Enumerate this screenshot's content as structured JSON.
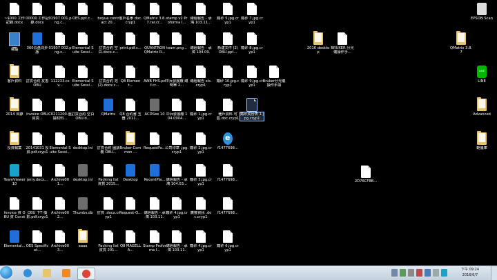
{
  "desktop": {
    "icons": [
      {
        "name": "file-icon",
        "kind": "file",
        "label": "~$000 工作記錄.docx"
      },
      {
        "name": "file-icon",
        "kind": "file",
        "label": "00000 工作記錄.docx"
      },
      {
        "name": "file-icon",
        "kind": "file",
        "label": "01907 001.png.c..."
      },
      {
        "name": "file-icon",
        "kind": "file",
        "label": "OES.ppt.c..."
      },
      {
        "name": "file-icon",
        "kind": "file",
        "label": "boyue contract 20..."
      },
      {
        "name": "file-icon",
        "kind": "file",
        "label": "客戶名單 doc.cryp1"
      },
      {
        "name": "file-icon",
        "kind": "file",
        "label": "QMatrix 3.8.7.rar.cr..."
      },
      {
        "name": "file-icon",
        "kind": "file",
        "label": "stamp v2 Proforma I..."
      },
      {
        "name": "file-icon",
        "kind": "file",
        "label": "總經報告 - 承鴻 103.11..."
      },
      {
        "name": "file-icon",
        "kind": "file",
        "label": "鐵砂 5.jpg.cryp1"
      },
      {
        "name": "file-icon",
        "kind": "file",
        "label": "鐵砂 7.jpg.cryp1"
      },
      {
        "name": "computer-icon",
        "kind": "pc",
        "label": "電腦"
      },
      {
        "name": "360-safe-icon",
        "kind": "blue",
        "label": "360云盘同步版"
      },
      {
        "name": "file-icon",
        "kind": "file",
        "label": "01907 002.png.c..."
      },
      {
        "name": "file-icon",
        "kind": "file",
        "label": "Elemental Suite Sessi..."
      },
      {
        "name": "file-icon",
        "kind": "file",
        "label": "訂貨合約 空白.docx.c..."
      },
      {
        "name": "file-icon",
        "kind": "file",
        "label": "print.pdf.c..."
      },
      {
        "name": "file-icon",
        "kind": "file",
        "label": "QUANTRON QMatrix R..."
      },
      {
        "name": "file-icon",
        "kind": "file",
        "label": "team.png..."
      },
      {
        "name": "file-icon",
        "kind": "file",
        "label": "總經報告 - 承鴻 104.09.2..."
      },
      {
        "name": "file-icon",
        "kind": "file",
        "label": "新建文件 (2) OBU.ppt..."
      },
      {
        "name": "file-icon",
        "kind": "file",
        "label": "鐵砂 8.jpg.cryp1"
      },
      {
        "name": "folder-icon",
        "kind": "folder",
        "label": "客戶資料"
      },
      {
        "name": "file-icon",
        "kind": "file",
        "label": "訂貨合約 友香 OBU"
      },
      {
        "name": "file-icon",
        "kind": "file",
        "label": "112233.csv..."
      },
      {
        "name": "file-icon",
        "kind": "file",
        "label": "Elemental Suite Sessi..."
      },
      {
        "name": "file-icon",
        "kind": "file",
        "label": "訂貨合約 范 (2).docx.c..."
      },
      {
        "name": "file-icon",
        "kind": "file",
        "label": "Q8 Element..."
      },
      {
        "name": "file-icon",
        "kind": "file",
        "label": "AWB FHS.pdf.cr..."
      },
      {
        "name": "file-icon",
        "kind": "file",
        "label": "中兵發展廠 總明單 2..."
      },
      {
        "name": "file-icon",
        "kind": "file",
        "label": "總經報告 xls.cryp1"
      },
      {
        "name": "file-icon",
        "kind": "file",
        "label": "鐵砂 10.jpg.cryp1"
      },
      {
        "name": "file-icon",
        "kind": "file",
        "label": "鐵砂 9.jpg.cryp1"
      },
      {
        "name": "file-icon",
        "kind": "file",
        "label": "Bruker分光儀 操作手冊"
      },
      {
        "name": "folder-icon",
        "kind": "folder",
        "label": "2014 目錄"
      },
      {
        "name": "file-icon",
        "kind": "file",
        "label": "Invoice OBU 資貨..."
      },
      {
        "name": "file-icon",
        "kind": "file",
        "label": "C0211200-盤據材料... "
      },
      {
        "name": "file-icon",
        "kind": "file",
        "label": "訂貨合約 空白 OBU.d..."
      },
      {
        "name": "qmatrix-icon",
        "kind": "blue",
        "label": "QMatrix"
      },
      {
        "name": "file-icon",
        "kind": "file",
        "label": "Q8 合約書 玉器 2011..."
      },
      {
        "name": "acdsee-icon",
        "kind": "gray",
        "label": "ACDSee 10"
      },
      {
        "name": "file-icon",
        "kind": "file",
        "label": "中兵發展廠 104.0904..."
      },
      {
        "name": "file-icon",
        "kind": "file",
        "label": "鐵砂 1.jpg.cryp1"
      },
      {
        "name": "file-icon",
        "kind": "file",
        "label": "種戶資料 可盈.doc.cryp1"
      },
      {
        "name": "file-icon",
        "kind": "file",
        "label": "鐵砂成份表 1.jpg.cryp1"
      },
      {
        "name": "folder-icon",
        "kind": "folder",
        "label": "投資報案"
      },
      {
        "name": "file-icon",
        "kind": "file",
        "label": "20141031 投資.pdf.cryp1"
      },
      {
        "name": "file-icon",
        "kind": "file",
        "label": "Elemental Suite Sessi..."
      },
      {
        "name": "file-icon",
        "kind": "file",
        "label": "desktop.ini"
      },
      {
        "name": "file-icon",
        "kind": "file",
        "label": "訂貨合約 園講義 OBU..."
      },
      {
        "name": "bruker-icon",
        "kind": "folder",
        "label": "Bruker Common ..."
      },
      {
        "name": "file-icon",
        "kind": "file",
        "label": "RequestFo..."
      },
      {
        "name": "file-icon",
        "kind": "file",
        "label": "公司印章 .jpg.cryp1"
      },
      {
        "name": "file-icon",
        "kind": "file",
        "label": "鐵砂 2.jpg.cryp1"
      },
      {
        "name": "ie-icon",
        "kind": "ie",
        "label": "f1477698..."
      },
      {
        "name": "teamviewer-icon",
        "kind": "teal",
        "label": "TeamViewer 10"
      },
      {
        "name": "file-icon",
        "kind": "file",
        "label": "jerry.docx..."
      },
      {
        "name": "file-icon",
        "kind": "file",
        "label": "Archive001..."
      },
      {
        "name": "gear-icon",
        "kind": "gray",
        "label": "desktop.ini"
      },
      {
        "name": "file-icon",
        "kind": "file",
        "label": "Packing list 資貨 2015..."
      },
      {
        "name": "desktop-shortcut-icon",
        "kind": "blue",
        "label": "Desktop"
      },
      {
        "name": "recentplaces-icon",
        "kind": "blue",
        "label": "RecentPla..."
      },
      {
        "name": "file-icon",
        "kind": "file",
        "label": "總經報告 - 承鴻 104.03..."
      },
      {
        "name": "file-icon",
        "kind": "file",
        "label": "鐵砂 3.jpg.cryp1"
      },
      {
        "name": "file-icon",
        "kind": "file",
        "label": "f1477698..."
      },
      {
        "name": "file-icon",
        "kind": "file",
        "label": "Invoice 資 OBU 資 Constr..."
      },
      {
        "name": "file-icon",
        "kind": "file",
        "label": "OBU 下T 價 影.pdf.cryp1"
      },
      {
        "name": "file-icon",
        "kind": "file",
        "label": "Archive002..."
      },
      {
        "name": "thumbs-icon",
        "kind": "gray",
        "label": "Thumbs.db"
      },
      {
        "name": "file-icon",
        "kind": "file",
        "label": "訂貨 .docx.cryp1"
      },
      {
        "name": "file-icon",
        "kind": "file",
        "label": "Request-O..."
      },
      {
        "name": "file-icon",
        "kind": "file",
        "label": "總經報告 - 承鴻 103.11.0..."
      },
      {
        "name": "file-icon",
        "kind": "file",
        "label": "鐵砂 4.jpg.cryp1"
      },
      {
        "name": "file-icon",
        "kind": "file",
        "label": "廣豐資訊 .doc.cryp1"
      },
      {
        "name": "file-icon",
        "kind": "file",
        "label": "f1477698..."
      },
      {
        "name": "elemental-icon",
        "kind": "blue",
        "label": "Elemental..."
      },
      {
        "name": "file-icon",
        "kind": "file",
        "label": "OES Specificat..."
      },
      {
        "name": "file-icon",
        "kind": "file",
        "label": "Archive003..."
      },
      {
        "name": "folder-icon",
        "kind": "folder",
        "label": "aaaa"
      },
      {
        "name": "file-icon",
        "kind": "file",
        "label": "Packing list 資貨 201..."
      },
      {
        "name": "file-icon",
        "kind": "file",
        "label": "Q8 MAGELLA..."
      },
      {
        "name": "file-icon",
        "kind": "file",
        "label": "Stamp Proforma I..."
      },
      {
        "name": "file-icon",
        "kind": "file",
        "label": "總經報告 - 承鴻 103.11.1..."
      },
      {
        "name": "file-icon",
        "kind": "file",
        "label": "鐵砂 4.jpg.cryp1"
      },
      {
        "name": "file-icon",
        "kind": "file",
        "label": "鐵砂 6.jpg.cryp1"
      },
      {
        "name": "folder-icon",
        "kind": "folder",
        "label": "2016 desktop"
      },
      {
        "name": "file-icon",
        "kind": "file",
        "label": "BRUKER 分光儀操作手..."
      },
      {
        "name": "file-icon",
        "kind": "file",
        "label": "2D76CF8B..."
      },
      {
        "name": "epson-scan-icon",
        "kind": "printer",
        "label": "EPSON Scan"
      },
      {
        "name": "folder-icon",
        "kind": "folder",
        "label": "QMatrix 3.8.7"
      },
      {
        "name": "line-icon",
        "kind": "line",
        "label": "LINE"
      },
      {
        "name": "folder-icon",
        "kind": "folder",
        "label": "Advanced"
      },
      {
        "name": "folder-icon",
        "kind": "folder",
        "label": "範優庫"
      }
    ]
  },
  "taskbar": {
    "apps": [
      {
        "name": "ie-taskbar-icon",
        "color": "#2f8fd8"
      },
      {
        "name": "explorer-taskbar-icon",
        "color": "#e8c56a"
      },
      {
        "name": "media-player-taskbar-icon",
        "color": "#f08a24"
      },
      {
        "name": "chrome-taskbar-icon",
        "color": "#db4437",
        "active": true
      }
    ],
    "clock": {
      "time": "下午 09:24",
      "date": "2016/6/7"
    }
  },
  "colors": {
    "desktop_bg": "#000000",
    "taskbar_bg": "#c4d1de"
  }
}
